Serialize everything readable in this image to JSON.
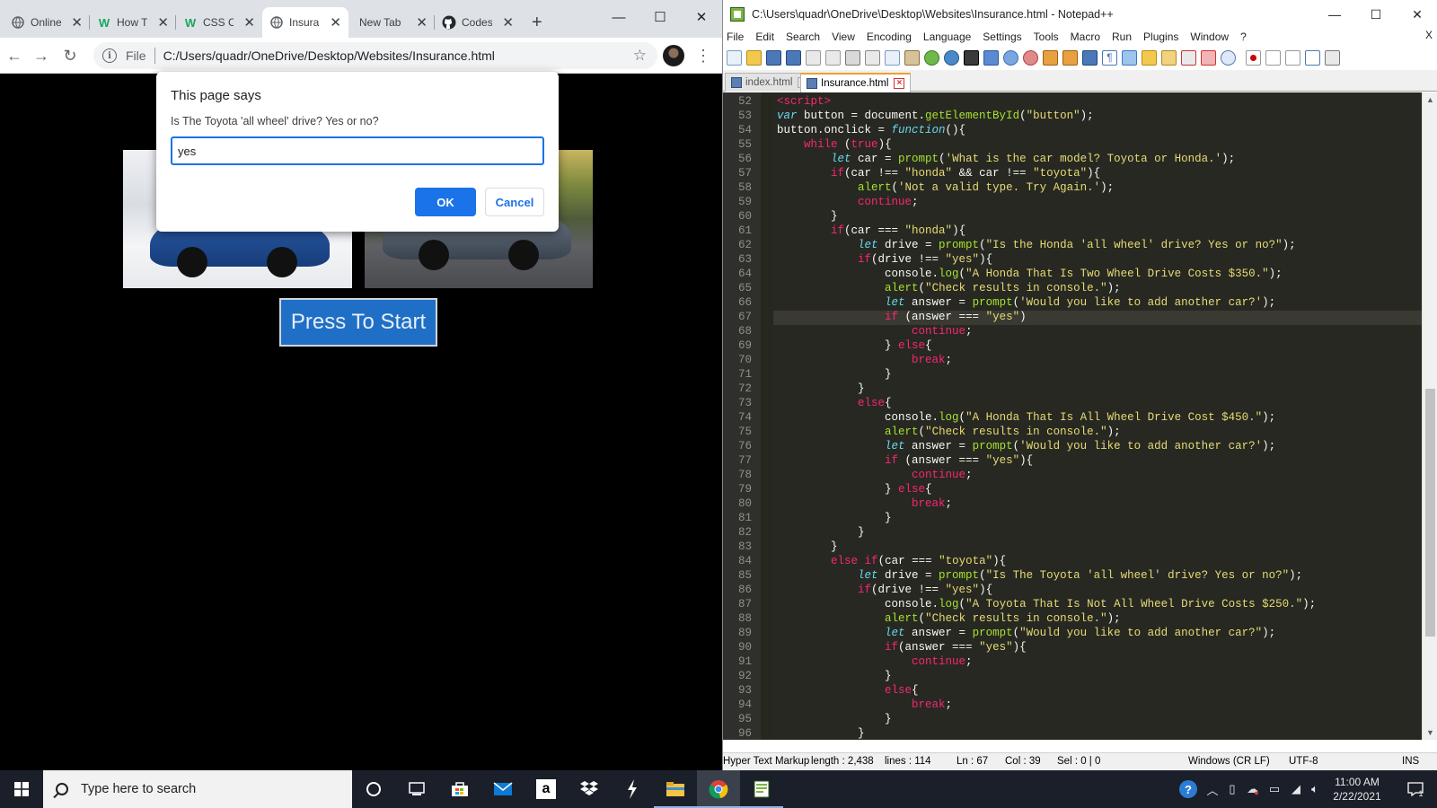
{
  "chrome": {
    "tabs": [
      {
        "label": "Online",
        "icon": "globe-icon"
      },
      {
        "label": "How T",
        "icon": "wix-icon"
      },
      {
        "label": "CSS C",
        "icon": "wix-icon"
      },
      {
        "label": "Insura",
        "icon": "globe-icon",
        "active": true
      },
      {
        "label": "New Tab",
        "icon": ""
      },
      {
        "label": "Codes",
        "icon": "github-icon"
      }
    ],
    "new_tab": "+",
    "omnibox": {
      "scheme": "File",
      "url": "C:/Users/quadr/OneDrive/Desktop/Websites/Insurance.html"
    },
    "page": {
      "button_label": "Press To Start"
    },
    "dialog": {
      "title": "This page says",
      "message": "Is The Toyota 'all wheel' drive? Yes or no?",
      "input_value": "yes",
      "ok_label": "OK",
      "cancel_label": "Cancel"
    }
  },
  "notepad": {
    "title": "C:\\Users\\quadr\\OneDrive\\Desktop\\Websites\\Insurance.html - Notepad++",
    "menu": [
      "File",
      "Edit",
      "Search",
      "View",
      "Encoding",
      "Language",
      "Settings",
      "Tools",
      "Macro",
      "Run",
      "Plugins",
      "Window",
      "?"
    ],
    "menu_close": "X",
    "tabs": [
      {
        "label": "index.html",
        "active": false
      },
      {
        "label": "Insurance.html",
        "active": true
      }
    ],
    "code": [
      {
        "n": "52",
        "t": "<script>"
      },
      {
        "n": "53",
        "t": "var button = document.getElementById(\"button\");"
      },
      {
        "n": "54",
        "t": "button.onclick = function(){"
      },
      {
        "n": "55",
        "t": "    while (true){"
      },
      {
        "n": "56",
        "t": "        let car = prompt('What is the car model? Toyota or Honda.');"
      },
      {
        "n": "57",
        "t": "        if(car !== \"honda\" && car !== \"toyota\"){"
      },
      {
        "n": "58",
        "t": "            alert('Not a valid type. Try Again.');"
      },
      {
        "n": "59",
        "t": "            continue;"
      },
      {
        "n": "60",
        "t": "        }"
      },
      {
        "n": "61",
        "t": "        if(car === \"honda\"){"
      },
      {
        "n": "62",
        "t": "            let drive = prompt(\"Is the Honda 'all wheel' drive? Yes or no?\");"
      },
      {
        "n": "63",
        "t": "            if(drive !== \"yes\"){"
      },
      {
        "n": "64",
        "t": "                console.log(\"A Honda That Is Two Wheel Drive Costs $350.\");"
      },
      {
        "n": "65",
        "t": "                alert(\"Check results in console.\");"
      },
      {
        "n": "66",
        "t": "                let answer = prompt('Would you like to add another car?');"
      },
      {
        "n": "67",
        "t": "                if (answer === \"yes\")"
      },
      {
        "n": "68",
        "t": "                    continue;"
      },
      {
        "n": "69",
        "t": "                } else{"
      },
      {
        "n": "70",
        "t": "                    break;"
      },
      {
        "n": "71",
        "t": "                }"
      },
      {
        "n": "72",
        "t": "            }"
      },
      {
        "n": "73",
        "t": "            else{"
      },
      {
        "n": "74",
        "t": "                console.log(\"A Honda That Is All Wheel Drive Cost $450.\");"
      },
      {
        "n": "75",
        "t": "                alert(\"Check results in console.\");"
      },
      {
        "n": "76",
        "t": "                let answer = prompt('Would you like to add another car?');"
      },
      {
        "n": "77",
        "t": "                if (answer === \"yes\"){"
      },
      {
        "n": "78",
        "t": "                    continue;"
      },
      {
        "n": "79",
        "t": "                } else{"
      },
      {
        "n": "80",
        "t": "                    break;"
      },
      {
        "n": "81",
        "t": "                }"
      },
      {
        "n": "82",
        "t": "            }"
      },
      {
        "n": "83",
        "t": "        }"
      },
      {
        "n": "84",
        "t": "        else if(car === \"toyota\"){"
      },
      {
        "n": "85",
        "t": "            let drive = prompt(\"Is The Toyota 'all wheel' drive? Yes or no?\");"
      },
      {
        "n": "86",
        "t": "            if(drive !== \"yes\"){"
      },
      {
        "n": "87",
        "t": "                console.log(\"A Toyota That Is Not All Wheel Drive Costs $250.\");"
      },
      {
        "n": "88",
        "t": "                alert(\"Check results in console.\");"
      },
      {
        "n": "89",
        "t": "                let answer = prompt(\"Would you like to add another car?\");"
      },
      {
        "n": "90",
        "t": "                if(answer === \"yes\"){"
      },
      {
        "n": "91",
        "t": "                    continue;"
      },
      {
        "n": "92",
        "t": "                }"
      },
      {
        "n": "93",
        "t": "                else{"
      },
      {
        "n": "94",
        "t": "                    break;"
      },
      {
        "n": "95",
        "t": "                }"
      },
      {
        "n": "96",
        "t": "            }"
      }
    ],
    "status": {
      "type": "Hyper Text Markup Language file",
      "length": "length : 2,438",
      "lines": "lines : 114",
      "ln": "Ln : 67",
      "col": "Col : 39",
      "sel": "Sel : 0 | 0",
      "eol": "Windows (CR LF)",
      "encoding": "UTF-8",
      "mode": "INS"
    }
  },
  "taskbar": {
    "search_placeholder": "Type here to search",
    "time": "11:00 AM",
    "date": "2/22/2021"
  }
}
